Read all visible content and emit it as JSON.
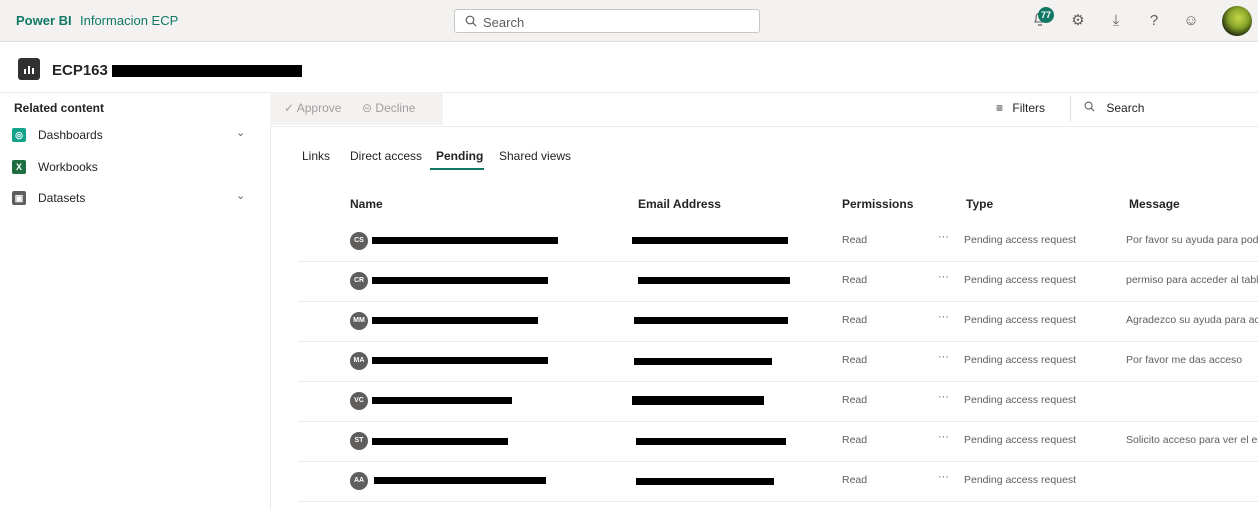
{
  "topbar": {
    "brand": "Power BI",
    "workspace": "Informacion ECP",
    "search_placeholder": "Search",
    "notification_count": "77"
  },
  "report": {
    "title_prefix": "ECP163"
  },
  "sidebar": {
    "title": "Related content",
    "items": [
      {
        "label": "Dashboards",
        "icon": "dashboard-icon",
        "color": "#13a38b"
      },
      {
        "label": "Workbooks",
        "icon": "excel-icon",
        "color": "#1d6f42"
      },
      {
        "label": "Datasets",
        "icon": "dataset-icon",
        "color": "#605e5c"
      }
    ]
  },
  "actions": {
    "approve": "Approve",
    "decline": "Decline",
    "filters": "Filters",
    "search": "Search"
  },
  "tabs": [
    "Links",
    "Direct access",
    "Pending",
    "Shared views"
  ],
  "active_tab": "Pending",
  "table": {
    "headers": {
      "name": "Name",
      "email": "Email Address",
      "permissions": "Permissions",
      "type": "Type",
      "message": "Message"
    },
    "rows": [
      {
        "initials": "CS",
        "permission": "Read",
        "type": "Pending access request",
        "message": "Por favor su ayuda para poder"
      },
      {
        "initials": "CR",
        "permission": "Read",
        "type": "Pending access request",
        "message": "permiso para acceder al tabler"
      },
      {
        "initials": "MM",
        "permission": "Read",
        "type": "Pending access request",
        "message": "Agradezco su ayuda para acce"
      },
      {
        "initials": "MA",
        "permission": "Read",
        "type": "Pending access request",
        "message": "Por favor me das acceso"
      },
      {
        "initials": "VC",
        "permission": "Read",
        "type": "Pending access request",
        "message": ""
      },
      {
        "initials": "ST",
        "permission": "Read",
        "type": "Pending access request",
        "message": "Solicito acceso para ver el esta"
      },
      {
        "initials": "AA",
        "permission": "Read",
        "type": "Pending access request",
        "message": ""
      }
    ]
  },
  "colors": {
    "accent": "#117865",
    "redaction": "#000000"
  }
}
